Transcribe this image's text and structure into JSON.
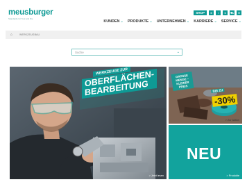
{
  "brand": {
    "logo": "meusburger",
    "tagline": "Standards for Tool and Die",
    "accent_color": "#0e9a95"
  },
  "topbar": {
    "shop_label": "SHOP",
    "icons": [
      "globe-icon",
      "info-icon",
      "user-icon",
      "cart-icon",
      "phone-icon"
    ],
    "icon_glyphs": [
      "⊕",
      "i",
      "●",
      "⛟",
      "✆"
    ]
  },
  "nav": {
    "items": [
      {
        "label": "KUNDEN",
        "chev": "⌄"
      },
      {
        "label": "PRODUKTE",
        "chev": "⌄"
      },
      {
        "label": "UNTERNEHMEN",
        "chev": "⌄"
      },
      {
        "label": "KARRIERE",
        "chev": "⌄"
      },
      {
        "label": "SERVICE",
        "chev": "⌄"
      }
    ]
  },
  "breadcrumb": {
    "home_glyph": "⌂",
    "text": "WERKZEUGBAU"
  },
  "search": {
    "placeholder": "Suche",
    "chevron": "⌄"
  },
  "hero": {
    "kicker": "WERKZEUGE ZUR",
    "title_line1": "OBERFLÄCHEN-",
    "title_line2": "BEARBEITUNG",
    "cta": "> Jetzt lesen"
  },
  "sale_tile": {
    "tag": "GROSSE MENGE – KLEINER PREIS",
    "bis": "BIS ZU",
    "percent": "-30%",
    "link": "> Zur Aktion"
  },
  "new_tile": {
    "text": "NEU",
    "link": "> Produkte"
  }
}
